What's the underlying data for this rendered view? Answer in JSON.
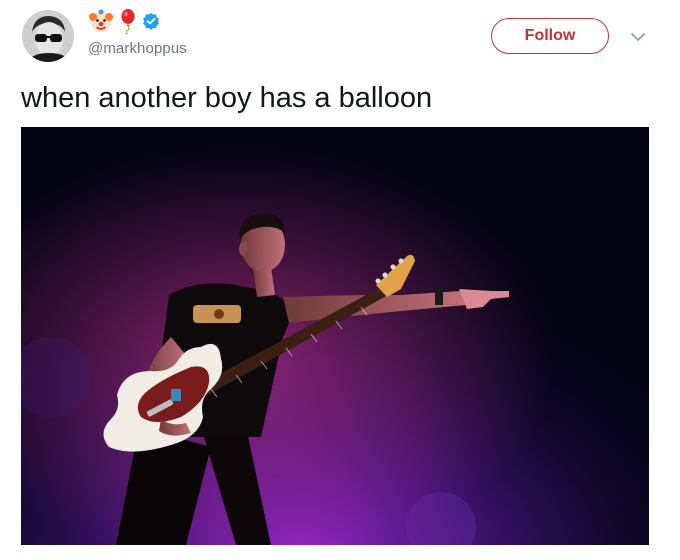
{
  "user": {
    "handle": "@markhoppus",
    "display_name_emojis": [
      "clown-face",
      "balloon"
    ],
    "verified": true,
    "avatar": "avatar-photo"
  },
  "follow_button": {
    "label": "Follow",
    "color": "#c62f3a"
  },
  "menu": {
    "icon": "chevron-down"
  },
  "tweet": {
    "text": "when another boy has a balloon"
  },
  "media": {
    "kind": "photo",
    "icon": "concert-photo"
  },
  "colors": {
    "verified_badge": "#1da1f2",
    "handle": "#657786",
    "text": "#14171a",
    "stage_light": "#7a1fb8"
  }
}
